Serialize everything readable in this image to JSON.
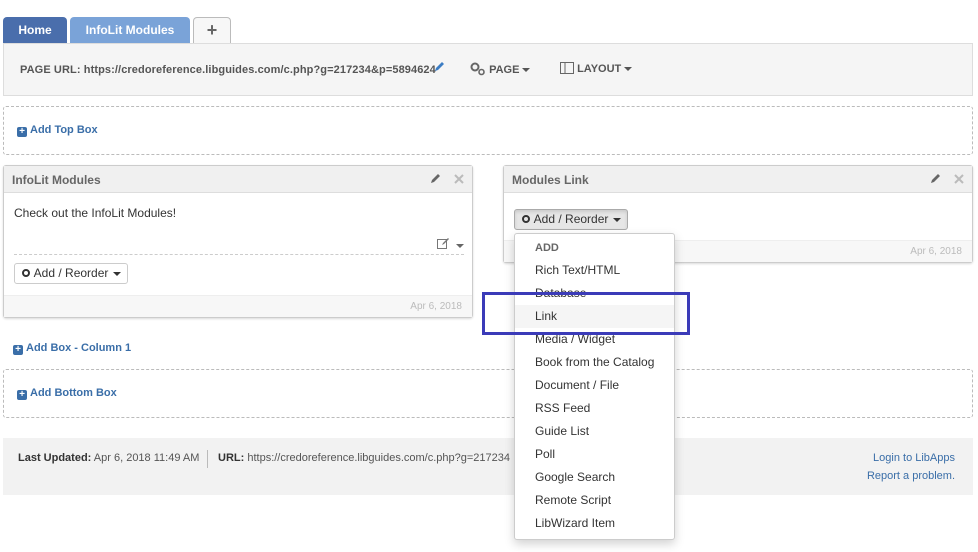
{
  "tabs": [
    {
      "label": "Home"
    },
    {
      "label": "InfoLit Modules"
    },
    {
      "label": "+"
    }
  ],
  "urlbar": {
    "label": "PAGE URL:",
    "url": "https://credoreference.libguides.com/c.php?g=217234&p=5894624",
    "page_menu": "PAGE",
    "layout_menu": "LAYOUT"
  },
  "add_top_box": "Add Top Box",
  "add_box_column": "Add Box - Column 1",
  "add_bottom_box": "Add Bottom Box",
  "panels": [
    {
      "title": "InfoLit Modules",
      "content": "Check out the InfoLit Modules!",
      "button": "Add / Reorder",
      "date": "Apr 6, 2018"
    },
    {
      "title": "Modules Link",
      "button": "Add / Reorder",
      "date": "Apr 6, 2018"
    }
  ],
  "dropdown": {
    "header": "ADD",
    "items": [
      "Rich Text/HTML",
      "Database",
      "Link",
      "Media / Widget",
      "Book from the Catalog",
      "Document / File",
      "RSS Feed",
      "Guide List",
      "Poll",
      "Google Search",
      "Remote Script",
      "LibWizard Item"
    ],
    "highlighted": "Link"
  },
  "footer": {
    "last_updated_label": "Last Updated:",
    "last_updated_value": "Apr 6, 2018 11:49 AM",
    "url_label": "URL:",
    "url_value": "https://credoreference.libguides.com/c.php?g=217234",
    "login_link": "Login to LibApps",
    "report_link": "Report a problem."
  },
  "colors": {
    "tab_active": "#4a6eac",
    "tab_secondary": "#7aa3d8",
    "link": "#3a6ea8",
    "highlight_box": "#3b3bb8"
  },
  "icons": [
    "plus-icon",
    "pencil-icon",
    "gear-icon",
    "layout-icon",
    "close-icon",
    "edit-icon",
    "caret-down-icon"
  ]
}
